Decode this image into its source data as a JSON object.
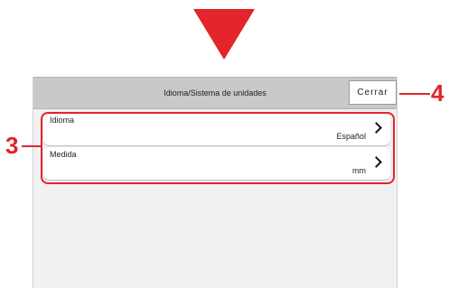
{
  "header": {
    "title": "Idioma/Sistema de unidades",
    "close_label": "Cerrar"
  },
  "items": [
    {
      "label": "Idioma",
      "value": "Español"
    },
    {
      "label": "Medida",
      "value": "mm"
    }
  ],
  "callouts": {
    "list_number": "3",
    "close_number": "4"
  },
  "colors": {
    "accent": "#e3242b",
    "header_bg": "#c9c9c9",
    "panel_bg": "#f1f1f1"
  }
}
